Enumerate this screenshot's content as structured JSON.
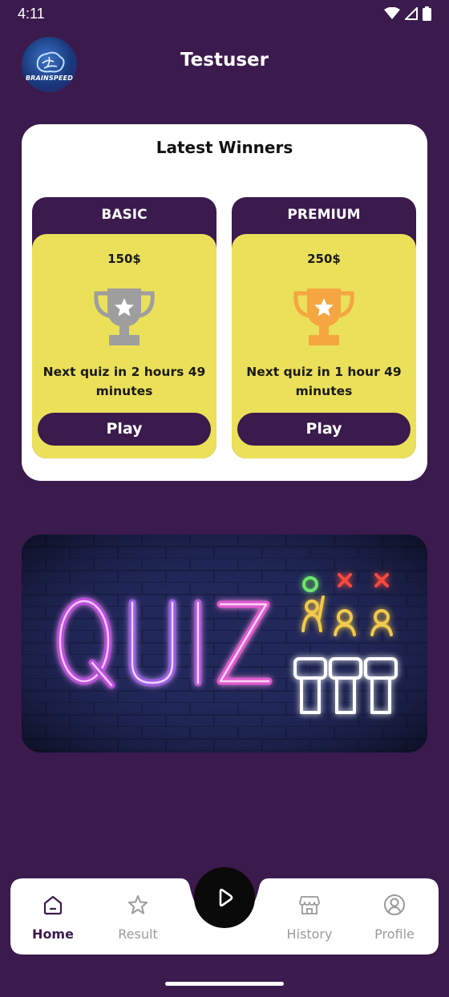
{
  "status": {
    "time": "4:11"
  },
  "header": {
    "username": "Testuser",
    "logo_text": "BRAINSPEED"
  },
  "winners": {
    "title": "Latest Winners",
    "tiers": [
      {
        "name": "BASIC",
        "prize": "150$",
        "next": "Next quiz in 2 hours 49 minutes",
        "play_label": "Play",
        "trophy_color": "#9e9e9e"
      },
      {
        "name": "PREMIUM",
        "prize": "250$",
        "next": "Next quiz in 1 hour 49 minutes",
        "play_label": "Play",
        "trophy_color": "#f5a640"
      }
    ]
  },
  "banner": {
    "text": "QUIZ"
  },
  "nav": {
    "items": [
      {
        "label": "Home",
        "icon": "home-icon",
        "active": true
      },
      {
        "label": "Result",
        "icon": "star-icon",
        "active": false
      },
      {
        "label": "History",
        "icon": "store-icon",
        "active": false
      },
      {
        "label": "Profile",
        "icon": "user-icon",
        "active": false
      }
    ],
    "center_icon": "play-icon"
  },
  "colors": {
    "brand": "#3b1a4d",
    "card_yellow": "#ebe05a",
    "white": "#ffffff"
  }
}
